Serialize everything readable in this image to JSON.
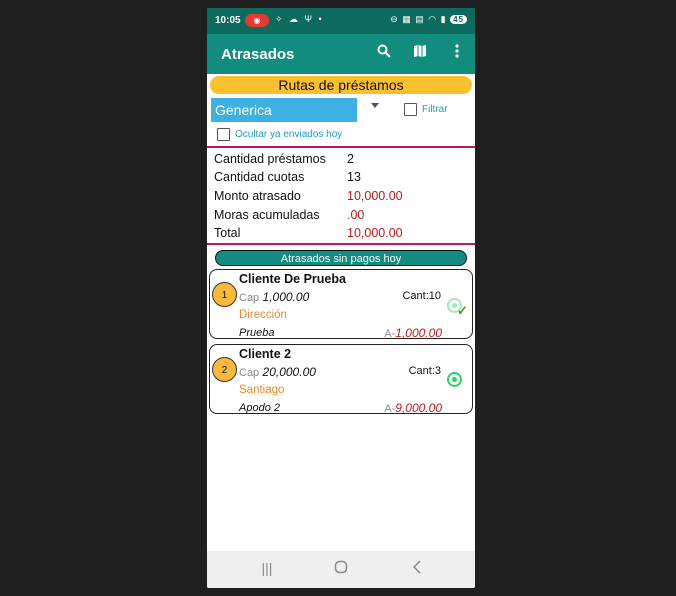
{
  "status": {
    "time": "10:05",
    "battery": "45"
  },
  "appbar": {
    "title": "Atrasados",
    "icons": [
      "search-icon",
      "map-icon",
      "more-vert-icon"
    ]
  },
  "filters": {
    "routes_title": "Rutas de préstamos",
    "route_selected": "Generica",
    "filter_label": "Filtrar",
    "hide_sent_label": "Ocultar ya enviados hoy"
  },
  "summary": [
    {
      "label": "Cantidad préstamos",
      "value": "2",
      "red": false
    },
    {
      "label": "Cantidad cuotas",
      "value": "13",
      "red": false
    },
    {
      "label": "Monto atrasado",
      "value": "10,000.00",
      "red": true
    },
    {
      "label": "Moras acumuladas",
      "value": ".00",
      "red": true
    },
    {
      "label": "Total",
      "value": "10,000.00",
      "red": true
    }
  ],
  "section_title": "Atrasados sin pagos hoy",
  "clients": [
    {
      "num": "1",
      "name": "Cliente De Prueba",
      "cap_label": "Cap",
      "cap": "1,000.00",
      "cant_label": "Cant:",
      "cant": "10",
      "address": "Dirección",
      "nickname": "Prueba",
      "late_label": "A-",
      "late": "1,000.00",
      "sent": true
    },
    {
      "num": "2",
      "name": "Cliente 2",
      "cap_label": "Cap",
      "cap": "20,000.00",
      "cant_label": "Cant:",
      "cant": "3",
      "address": "Santiago",
      "nickname": "Apodo 2",
      "late_label": "A-",
      "late": "9,000.00",
      "sent": false
    }
  ],
  "colors": {
    "appbar": "#128c7e",
    "statusbar": "#0d6b5e",
    "accent_yellow": "#fbc02d",
    "red_value": "#b71c1c",
    "divider": "#c2185b"
  }
}
